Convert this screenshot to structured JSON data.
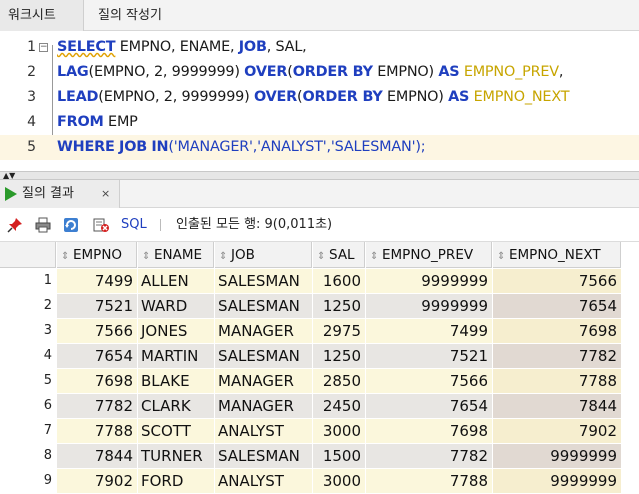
{
  "tabs": {
    "worksheet": "워크시트",
    "query_builder": "질의 작성기"
  },
  "editor": {
    "lines": [
      {
        "no": "1"
      },
      {
        "no": "2"
      },
      {
        "no": "3"
      },
      {
        "no": "4"
      },
      {
        "no": "5"
      }
    ],
    "tokens": {
      "l1_select": "SELECT",
      "l1_rest": " EMPNO, ENAME, ",
      "l1_job": "JOB",
      "l1_end": ", SAL,",
      "l2_lag": "LAG",
      "l2_args": "(EMPNO, 2, 9999999) ",
      "l2_over": "OVER",
      "l2_paren": "(",
      "l2_order": "ORDER BY",
      "l2_col": " EMPNO) ",
      "l2_as": "AS",
      "l2_sp": " ",
      "l2_alias": "EMPNO_PREV",
      "l2_end": ",",
      "l3_lead": "LEAD",
      "l3_args": "(EMPNO, 2, 9999999) ",
      "l3_over": "OVER",
      "l3_paren": "(",
      "l3_order": "ORDER BY",
      "l3_col": " EMPNO) ",
      "l3_as": "AS",
      "l3_sp": " ",
      "l3_alias": "EMPNO_NEXT",
      "l4_from": "FROM",
      "l4_rest": " EMP",
      "l5_where": "WHERE",
      "l5_sp": " ",
      "l5_job": "JOB",
      "l5_sp2": " ",
      "l5_in": "IN",
      "l5_list": "('MANAGER','ANALYST','SALESMAN');"
    }
  },
  "result_tab": {
    "label": "질의 결과",
    "close": "×"
  },
  "toolbar": {
    "sql_label": "SQL",
    "status": "인출된 모든 행: 9(0,011초)"
  },
  "grid": {
    "columns": [
      "EMPNO",
      "ENAME",
      "JOB",
      "SAL",
      "EMPNO_PREV",
      "EMPNO_NEXT"
    ],
    "rows": [
      {
        "n": "1",
        "empno": "7499",
        "ename": "ALLEN",
        "job": "SALESMAN",
        "sal": "1600",
        "prev": "9999999",
        "next": "7566"
      },
      {
        "n": "2",
        "empno": "7521",
        "ename": "WARD",
        "job": "SALESMAN",
        "sal": "1250",
        "prev": "9999999",
        "next": "7654"
      },
      {
        "n": "3",
        "empno": "7566",
        "ename": "JONES",
        "job": "MANAGER",
        "sal": "2975",
        "prev": "7499",
        "next": "7698"
      },
      {
        "n": "4",
        "empno": "7654",
        "ename": "MARTIN",
        "job": "SALESMAN",
        "sal": "1250",
        "prev": "7521",
        "next": "7782"
      },
      {
        "n": "5",
        "empno": "7698",
        "ename": "BLAKE",
        "job": "MANAGER",
        "sal": "2850",
        "prev": "7566",
        "next": "7788"
      },
      {
        "n": "6",
        "empno": "7782",
        "ename": "CLARK",
        "job": "MANAGER",
        "sal": "2450",
        "prev": "7654",
        "next": "7844"
      },
      {
        "n": "7",
        "empno": "7788",
        "ename": "SCOTT",
        "job": "ANALYST",
        "sal": "3000",
        "prev": "7698",
        "next": "7902"
      },
      {
        "n": "8",
        "empno": "7844",
        "ename": "TURNER",
        "job": "SALESMAN",
        "sal": "1500",
        "prev": "7782",
        "next": "9999999"
      },
      {
        "n": "9",
        "empno": "7902",
        "ename": "FORD",
        "job": "ANALYST",
        "sal": "3000",
        "prev": "7788",
        "next": "9999999"
      }
    ]
  },
  "colors": {
    "keyword": "#1f3fbf",
    "alias": "#c7a500",
    "row_odd": "#fbf7dc",
    "row_even": "#e8e6e3",
    "run_icon": "#2a9a2a"
  }
}
